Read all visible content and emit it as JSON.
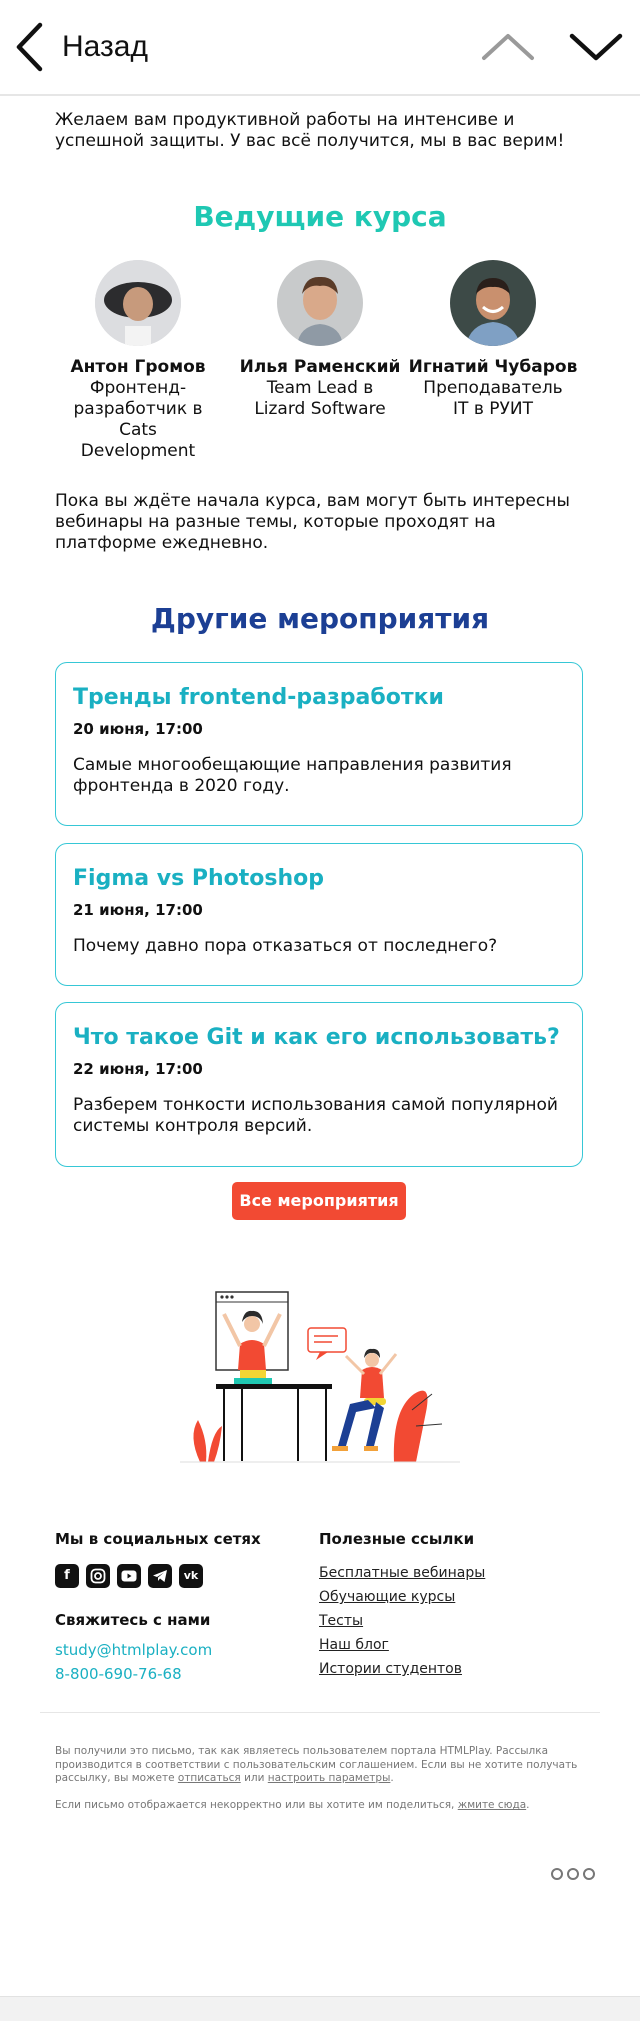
{
  "topbar": {
    "back_label": "Назад",
    "icons": [
      "back-chevron-icon",
      "chevron-up-icon",
      "chevron-down-icon"
    ]
  },
  "intro": "Желаем вам продуктивной работы на интенсиве и успешной защиты. У вас всё получится, мы в вас верим!",
  "instructors": {
    "title": "Ведущие курса",
    "title_color": "#1fc8b3",
    "people": [
      {
        "name": "Антон Громов",
        "role": "Фронтенд-разработчик в Cats Development"
      },
      {
        "name": "Илья Раменский",
        "role": "Team Lead в Lizard Software"
      },
      {
        "name": "Игнатий Чубаров",
        "role": "Преподаватель IT в РУИТ"
      }
    ]
  },
  "webinars_note": "Пока вы ждёте начала курса, вам могут быть интересны вебинары на разные темы, которые проходят на платформе ежедневно.",
  "events": {
    "title": "Другие мероприятия",
    "title_color": "#1c3f94",
    "items": [
      {
        "title": "Тренды frontend-разработки",
        "date": "20 июня, 17:00",
        "description": "Самые многообещающие направления развития фронтенда в 2020 году."
      },
      {
        "title": "Figma vs Photoshop",
        "date": "21 июня, 17:00",
        "description": "Почему давно пора отказаться от последнего?"
      },
      {
        "title": "Что такое Git и как его использовать?",
        "date": "22 июня, 17:00",
        "description": "Разберем тонкости использования самой популярной системы контроля версий."
      }
    ],
    "all_button": "Все мероприятия",
    "button_color": "#f24a33"
  },
  "footer": {
    "social_title": "Мы в социальных сетях",
    "social_icons": [
      "facebook-icon",
      "instagram-icon",
      "youtube-icon",
      "telegram-icon",
      "vk-icon"
    ],
    "contact_title": "Свяжитесь с нами",
    "email": "study@htmlplay.com",
    "phone": "8-800-690-76-68",
    "links_title": "Полезные ссылки",
    "links": [
      "Бесплатные вебинары",
      "Обучающие курсы",
      "Тесты",
      "Наш блог",
      "Истории студентов"
    ]
  },
  "disclaimer": {
    "text1": "Вы получили это письмо, так как являетесь пользователем портала HTMLPlay. Рассылка производится в соответствии с пользовательским соглашением. Если вы не хотите получать рассылку, вы можете",
    "unsubscribe": "отписаться",
    "or": "или",
    "settings": "настроить параметры",
    "text2": "Если письмо отображается некорректно или вы хотите им поделиться,",
    "here": "жмите сюда"
  },
  "accent_color": "#1ab0c2"
}
